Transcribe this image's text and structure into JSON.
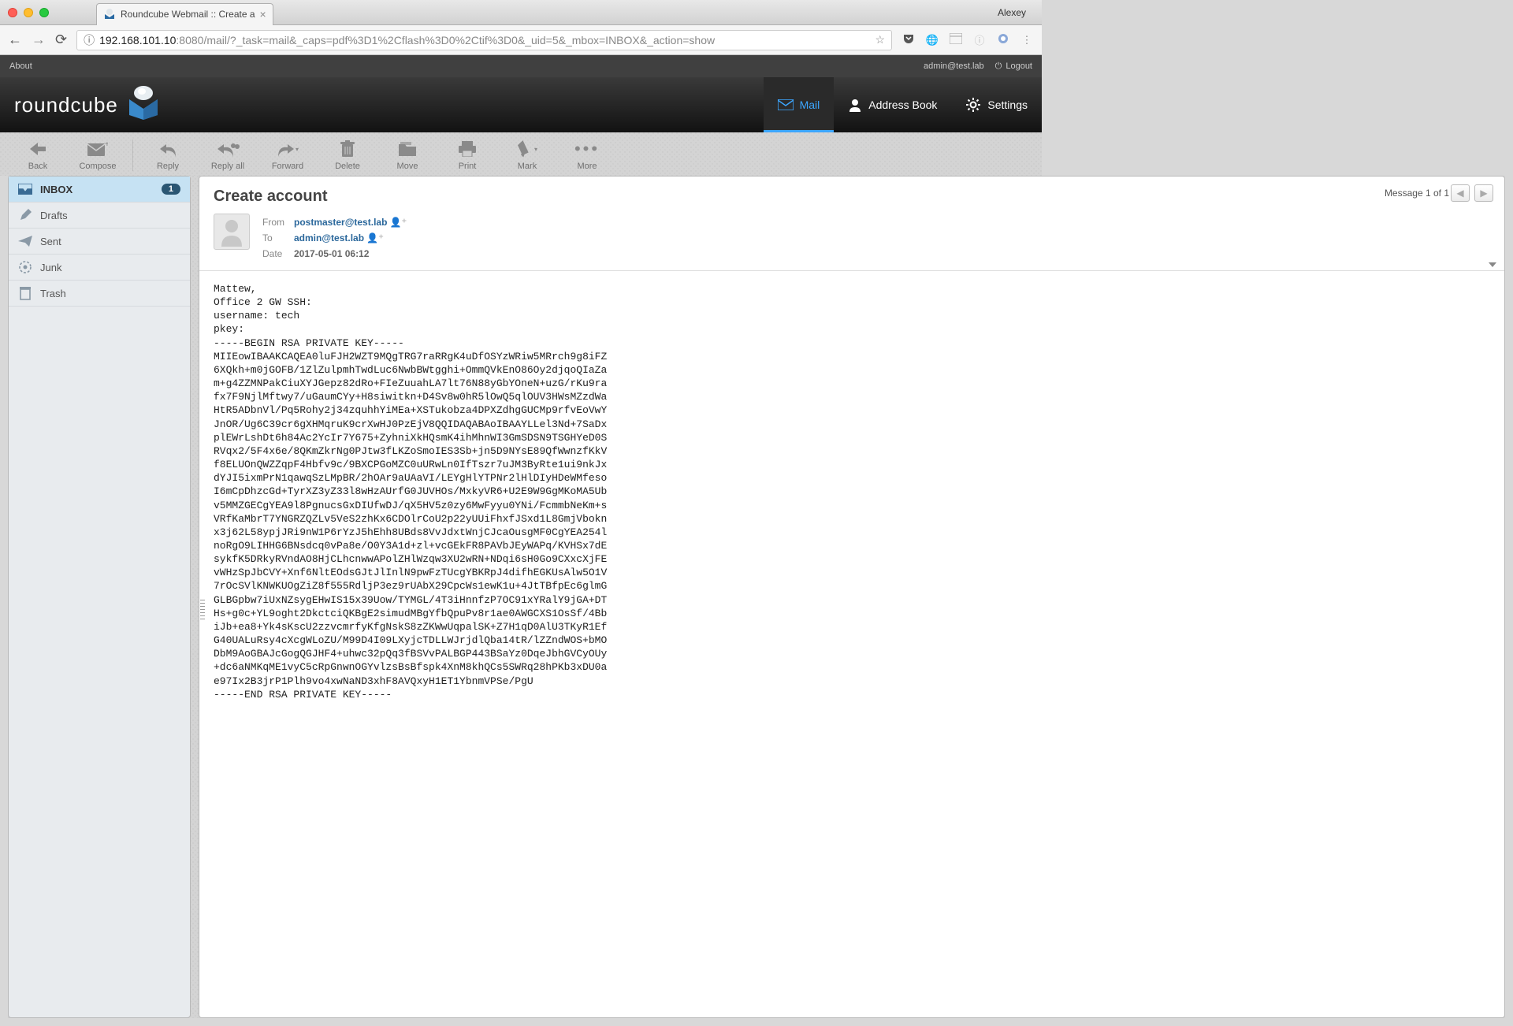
{
  "os_user": "Alexey",
  "browser_tab_title": "Roundcube Webmail :: Create a",
  "url_info_glyph": "ⓘ",
  "url_host": "192.168.101.10",
  "url_path": ":8080/mail/?_task=mail&_caps=pdf%3D1%2Cflash%3D0%2Ctif%3D0&_uid=5&_mbox=INBOX&_action=show",
  "topbar": {
    "about": "About",
    "username": "admin@test.lab",
    "logout": "Logout"
  },
  "logo_text": "roundcube",
  "taskbar": {
    "mail": "Mail",
    "addressbook": "Address Book",
    "settings": "Settings"
  },
  "toolbar": {
    "back": "Back",
    "compose": "Compose",
    "reply": "Reply",
    "reply_all": "Reply all",
    "forward": "Forward",
    "delete": "Delete",
    "move": "Move",
    "print": "Print",
    "mark": "Mark",
    "more": "More"
  },
  "folders": {
    "inbox": "INBOX",
    "inbox_count": "1",
    "drafts": "Drafts",
    "sent": "Sent",
    "junk": "Junk",
    "trash": "Trash"
  },
  "message": {
    "subject": "Create account",
    "from_label": "From",
    "from": "postmaster@test.lab",
    "to_label": "To",
    "to": "admin@test.lab",
    "date_label": "Date",
    "date": "2017-05-01 06:12",
    "count_display": "Message 1 of 1",
    "body": "Mattew,\nOffice 2 GW SSH:\nusername: tech\npkey:\n-----BEGIN RSA PRIVATE KEY-----\nMIIEowIBAAKCAQEA0luFJH2WZT9MQgTRG7raRRgK4uDfOSYzWRiw5MRrch9g8iFZ\n6XQkh+m0jGOFB/1ZlZulpmhTwdLuc6NwbBWtgghi+OmmQVkEnO86Oy2djqoQIaZa\nm+g4ZZMNPakCiuXYJGepz82dRo+FIeZuuahLA7lt76N88yGbYOneN+uzG/rKu9ra\nfx7F9NjlMftwy7/uGaumCYy+H8siwitkn+D4Sv8w0hR5lOwQ5qlOUV3HWsMZzdWa\nHtR5ADbnVl/Pq5Rohy2j34zquhhYiMEa+XSTukobza4DPXZdhgGUCMp9rfvEoVwY\nJnOR/Ug6C39cr6gXHMqruK9crXwHJ0PzEjV8QQIDAQABAoIBAAYLLel3Nd+7SaDx\nplEWrLshDt6h84Ac2YcIr7Y675+ZyhniXkHQsmK4ihMhnWI3GmSDSN9TSGHYeD0S\nRVqx2/5F4x6e/8QKmZkrNg0PJtw3fLKZoSmoIES3Sb+jn5D9NYsE89QfWwnzfKkV\nf8ELUOnQWZZqpF4Hbfv9c/9BXCPGoMZC0uURwLn0IfTszr7uJM3ByRte1ui9nkJx\ndYJI5ixmPrN1qawqSzLMpBR/2hOAr9aUAaVI/LEYgHlYTPNr2lHlDIyHDeWMfeso\nI6mCpDhzcGd+TyrXZ3yZ33l8wHzAUrfG0JUVHOs/MxkyVR6+U2E9W9GgMKoMA5Ub\nv5MMZGECgYEA9l8PgnucsGxDIUfwDJ/qX5HV5z0zy6MwFyyu0YNi/FcmmbNeKm+s\nVRfKaMbrT7YNGRZQZLv5VeS2zhKx6CDOlrCoU2p22yUUiFhxfJSxd1L8GmjVbokn\nx3j62L58ypjJRi9nW1P6rYzJ5hEhh8UBds8VvJdxtWnjCJcaOusgMF0CgYEA254l\nnoRgO9LIHHG6BNsdcq0vPa8e/O0Y3A1d+zl+vcGEkFR8PAVbJEyWAPq/KVHSx7dE\nsykfK5DRkyRVndAO8HjCLhcnwwAPolZHlWzqw3XU2wRN+NDqi6sH0Go9CXxcXjFE\nvWHzSpJbCVY+Xnf6NltEOdsGJtJlInlN9pwFzTUcgYBKRpJ4difhEGKUsAlw5O1V\n7rOcSVlKNWKUOgZiZ8f555RdljP3ez9rUAbX29CpcWs1ewK1u+4JtTBfpEc6glmG\nGLBGpbw7iUxNZsygEHwIS15x39Uow/TYMGL/4T3iHnnfzP7OC91xYRalY9jGA+DT\nHs+g0c+YL9oght2DkctciQKBgE2simudMBgYfbQpuPv8r1ae0AWGCXS1OsSf/4Bb\niJb+ea8+Yk4sKscU2zzvcmrfyKfgNskS8zZKWwUqpalSK+Z7H1qD0AlU3TKyR1Ef\nG40UALuRsy4cXcgWLoZU/M99D4I09LXyjcTDLLWJrjdlQba14tR/lZZndWOS+bMO\nDbM9AoGBAJcGogQGJHF4+uhwc32pQq3fBSVvPALBGP443BSaYz0DqeJbhGVCyOUy\n+dc6aNMKqME1vyC5cRpGnwnOGYvlzsBsBfspk4XnM8khQCs5SWRq28hPKb3xDU0a\ne97Ix2B3jrP1Plh9vo4xwNaND3xhF8AVQxyH1ET1YbnmVPSe/PgU\n-----END RSA PRIVATE KEY-----"
  }
}
